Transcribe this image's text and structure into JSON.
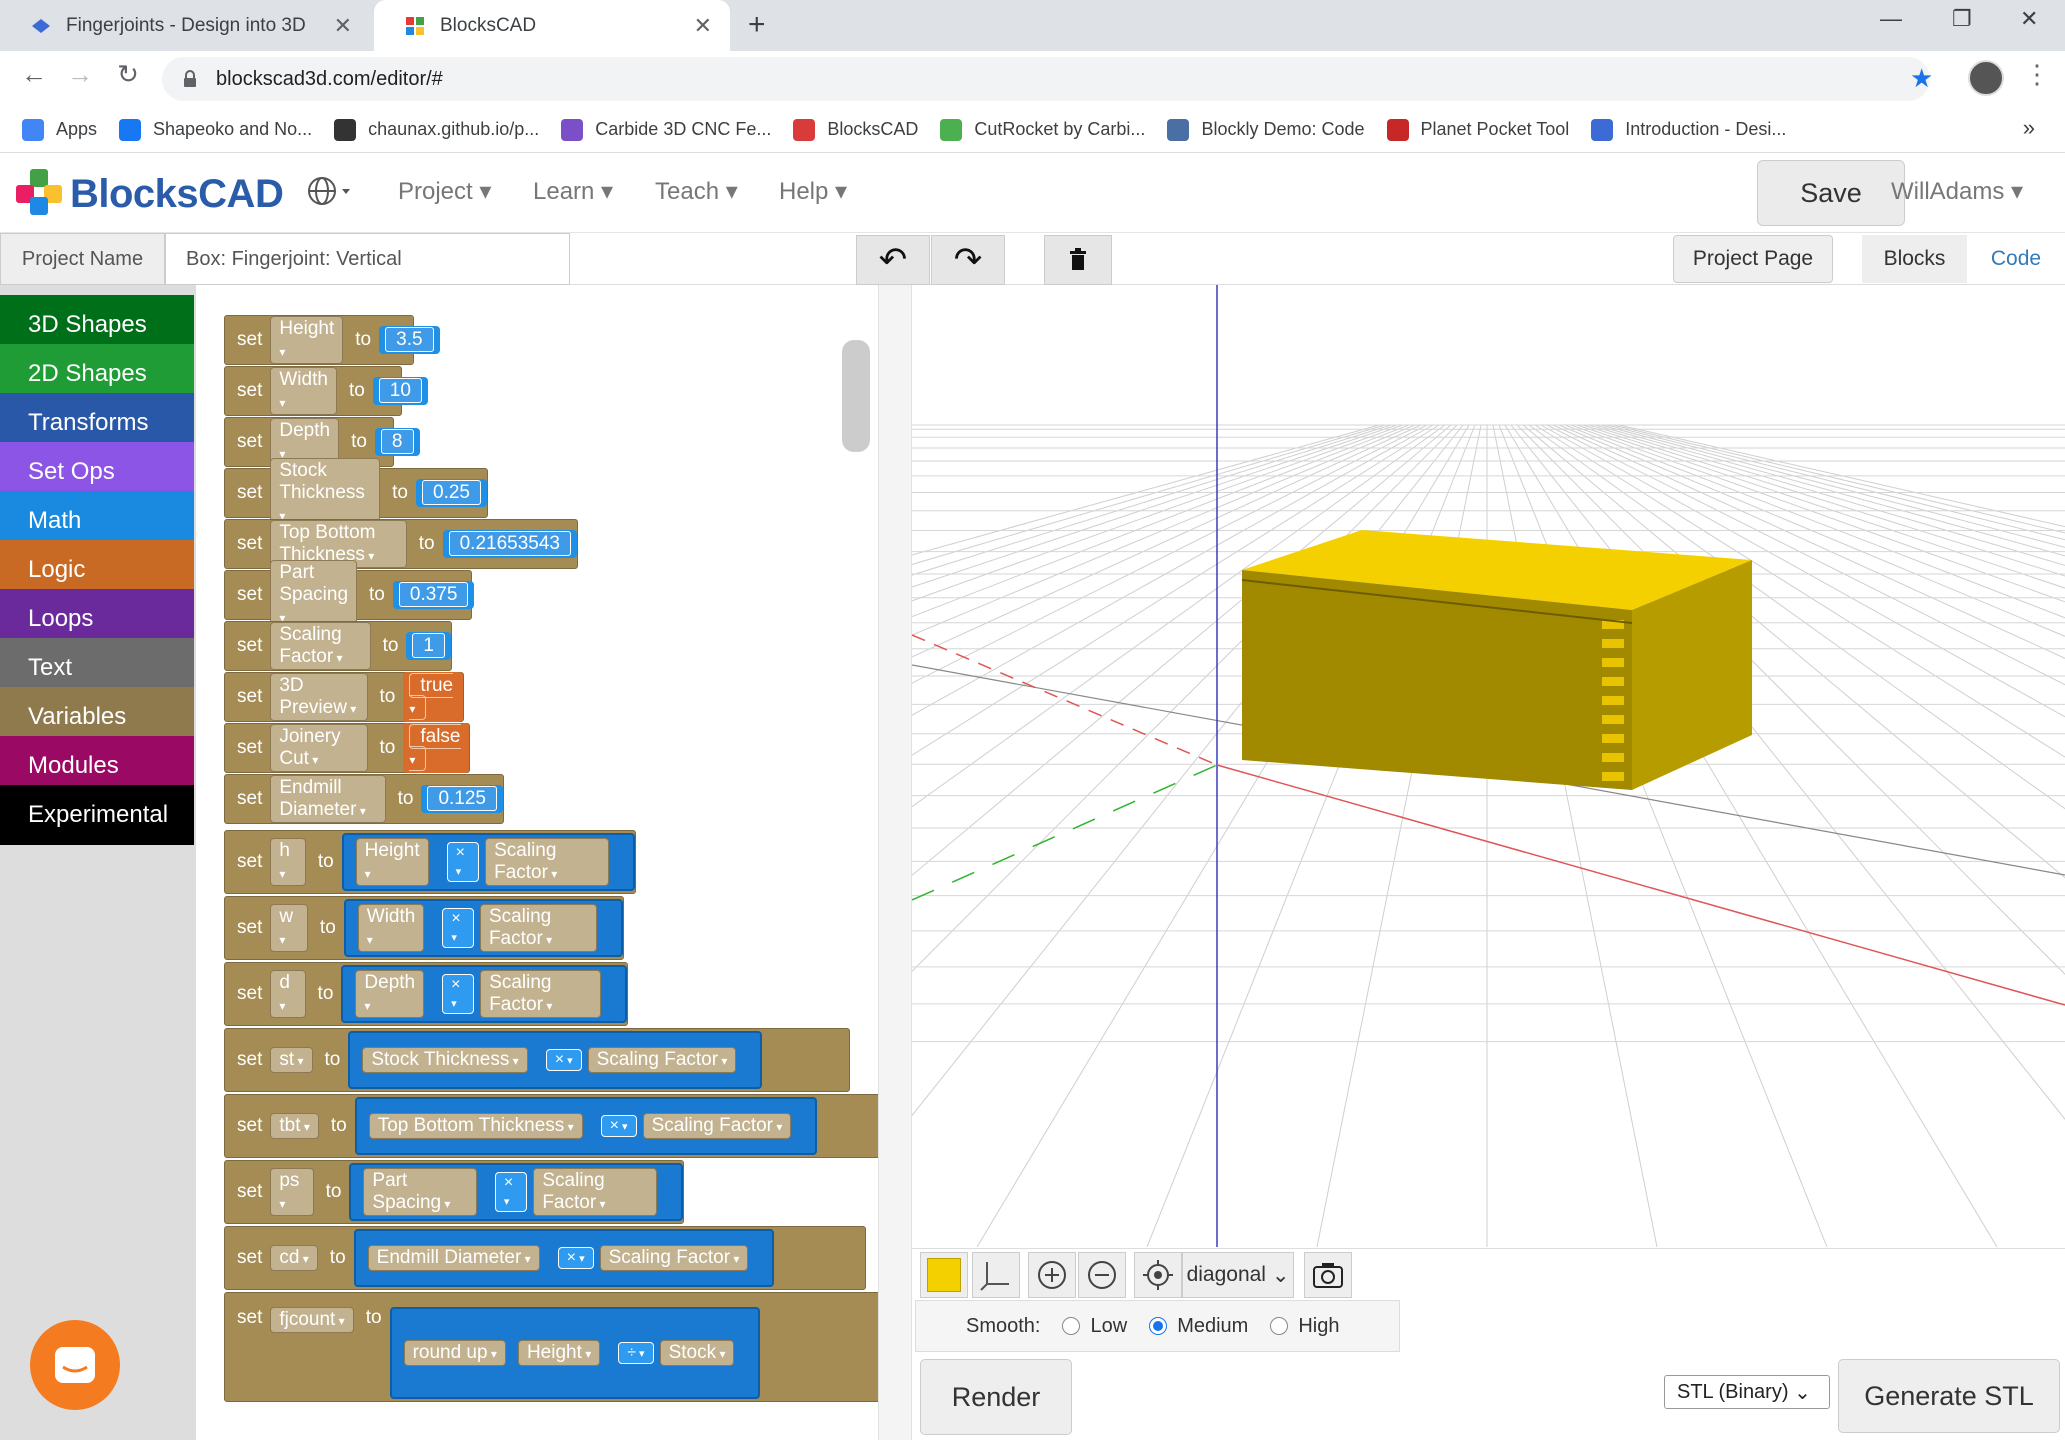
{
  "browser": {
    "tabs": [
      {
        "title": "Fingerjoints - Design into 3D",
        "close": "✕"
      },
      {
        "title": "BlocksCAD",
        "close": "✕"
      }
    ],
    "new_tab": "+",
    "window_controls": {
      "minimize": "—",
      "restore": "❐",
      "close": "✕"
    },
    "nav": {
      "back": "←",
      "forward": "→",
      "reload": "↻"
    },
    "url": "blockscad3d.com/editor/#",
    "star": "★",
    "menu": "⋮",
    "bookmarks": [
      {
        "label": "Apps",
        "icon": "apps-grid-icon",
        "color": "#4285f4"
      },
      {
        "label": "Shapeoko and No...",
        "icon": "facebook-icon",
        "color": "#1877f2"
      },
      {
        "label": "chaunax.github.io/p...",
        "icon": "github-icon",
        "color": "#333333"
      },
      {
        "label": "Carbide 3D CNC Fe...",
        "icon": "carbide-icon",
        "color": "#7b4fc7"
      },
      {
        "label": "BlocksCAD",
        "icon": "blockscad-icon",
        "color": "#d93a3a"
      },
      {
        "label": "CutRocket by Carbi...",
        "icon": "cutrocket-icon",
        "color": "#4caf50"
      },
      {
        "label": "Blockly Demo: Code",
        "icon": "blockly-icon",
        "color": "#4a6fa5"
      },
      {
        "label": "Planet Pocket Tool",
        "icon": "planet-icon",
        "color": "#c62828"
      },
      {
        "label": "Introduction - Desi...",
        "icon": "gitbook-icon",
        "color": "#3d6bd6"
      }
    ],
    "bookmarks_more": "»"
  },
  "app": {
    "logo_text": "BlocksCAD",
    "menus": [
      "Project",
      "Learn",
      "Teach",
      "Help"
    ],
    "save_label": "Save",
    "user": "WillAdams",
    "project_label": "Project Name",
    "project_name": "Box: Fingerjoint: Vertical",
    "undo": "↶",
    "redo": "↷",
    "trash": "🗑",
    "project_page": "Project Page",
    "blocks_tab": "Blocks",
    "code_tab": "Code"
  },
  "categories": [
    {
      "label": "3D Shapes",
      "color": "#006f1a"
    },
    {
      "label": "2D Shapes",
      "color": "#1f9c35"
    },
    {
      "label": "Transforms",
      "color": "#2a58a8"
    },
    {
      "label": "Set Ops",
      "color": "#8c55e6"
    },
    {
      "label": "Math",
      "color": "#1a8ae0"
    },
    {
      "label": "Logic",
      "color": "#c86a24"
    },
    {
      "label": "Loops",
      "color": "#6a2a9c"
    },
    {
      "label": "Text",
      "color": "#6c6c6c"
    },
    {
      "label": "Variables",
      "color": "#8f7a4e"
    },
    {
      "label": "Modules",
      "color": "#9a0a64"
    },
    {
      "label": "Experimental",
      "color": "#000000"
    }
  ],
  "blocks": {
    "set": "set",
    "to": "to",
    "times": "×",
    "divide": "÷",
    "simple": [
      {
        "var": "Height",
        "value": "3.5",
        "kind": "num"
      },
      {
        "var": "Width",
        "value": "10",
        "kind": "num"
      },
      {
        "var": "Depth",
        "value": "8",
        "kind": "num"
      },
      {
        "var": "Stock Thickness",
        "value": "0.25",
        "kind": "num"
      },
      {
        "var": "Top Bottom Thickness",
        "value": "0.21653543",
        "kind": "num"
      },
      {
        "var": "Part Spacing",
        "value": "0.375",
        "kind": "num"
      },
      {
        "var": "Scaling Factor",
        "value": "1",
        "kind": "num"
      },
      {
        "var": "3D Preview",
        "value": "true",
        "kind": "bool"
      },
      {
        "var": "Joinery Cut",
        "value": "false",
        "kind": "bool"
      },
      {
        "var": "Endmill Diameter",
        "value": "0.125",
        "kind": "num"
      }
    ],
    "scaled": [
      {
        "var": "h",
        "a": "Height",
        "b": "Scaling Factor"
      },
      {
        "var": "w",
        "a": "Width",
        "b": "Scaling Factor"
      },
      {
        "var": "d",
        "a": "Depth",
        "b": "Scaling Factor"
      },
      {
        "var": "st",
        "a": "Stock Thickness",
        "b": "Scaling Factor"
      },
      {
        "var": "tbt",
        "a": "Top Bottom Thickness",
        "b": "Scaling Factor"
      },
      {
        "var": "ps",
        "a": "Part Spacing",
        "b": "Scaling Factor"
      },
      {
        "var": "cd",
        "a": "Endmill Diameter",
        "b": "Scaling Factor"
      }
    ],
    "fjcount": {
      "var": "fjcount",
      "func": "round up",
      "a": "Height",
      "b": "Stock"
    }
  },
  "viewer": {
    "view_mode": "diagonal",
    "model_color": "#f5d000",
    "smooth_label": "Smooth:",
    "smooth_options": [
      "Low",
      "Medium",
      "High"
    ],
    "smooth_selected": "Medium",
    "render_label": "Render",
    "format": "STL (Binary)",
    "generate_label": "Generate STL"
  }
}
